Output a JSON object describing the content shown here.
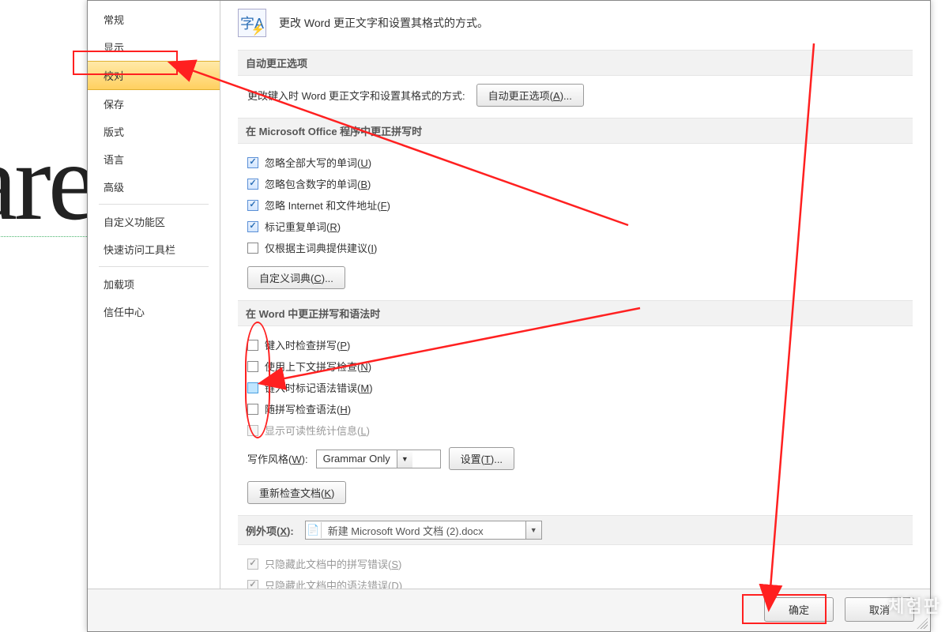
{
  "bg_text": "are",
  "header": {
    "icon_label": "字A",
    "description": "更改 Word 更正文字和设置其格式的方式。"
  },
  "sidebar": {
    "items": [
      {
        "label": "常规"
      },
      {
        "label": "显示"
      },
      {
        "label": "校对",
        "active": true
      },
      {
        "label": "保存"
      },
      {
        "label": "版式"
      },
      {
        "label": "语言"
      },
      {
        "label": "高级"
      }
    ],
    "items2": [
      {
        "label": "自定义功能区"
      },
      {
        "label": "快速访问工具栏"
      }
    ],
    "items3": [
      {
        "label": "加载项"
      },
      {
        "label": "信任中心"
      }
    ]
  },
  "sections": {
    "autocorrect": {
      "title": "自动更正选项",
      "row_label": "更改键入时 Word 更正文字和设置其格式的方式:",
      "button": "自动更正选项(A)..."
    },
    "office_spell": {
      "title": "在 Microsoft Office 程序中更正拼写时",
      "checks": [
        {
          "label": "忽略全部大写的单词(U)",
          "checked": true
        },
        {
          "label": "忽略包含数字的单词(B)",
          "checked": true
        },
        {
          "label": "忽略 Internet 和文件地址(F)",
          "checked": true
        },
        {
          "label": "标记重复单词(R)",
          "checked": true
        },
        {
          "label": "仅根据主词典提供建议(I)",
          "checked": false
        }
      ],
      "dict_button": "自定义词典(C)..."
    },
    "word_spell": {
      "title": "在 Word 中更正拼写和语法时",
      "checks": [
        {
          "label": "键入时检查拼写(P)",
          "checked": false
        },
        {
          "label": "使用上下文拼写检查(N)",
          "checked": false
        },
        {
          "label": "键入时标记语法错误(M)",
          "checked": false,
          "highlight": true
        },
        {
          "label": "随拼写检查语法(H)",
          "checked": false
        },
        {
          "label": "显示可读性统计信息(L)",
          "checked": false,
          "disabled": true
        }
      ],
      "style_label": "写作风格(W):",
      "style_value": "Grammar Only",
      "settings_button": "设置(T)...",
      "recheck_button": "重新检查文档(K)"
    },
    "exceptions": {
      "title_label": "例外项(X):",
      "doc_value": "新建 Microsoft Word 文档 (2).docx",
      "hide_spelling": "只隐藏此文档中的拼写错误(S)",
      "hide_grammar": "只隐藏此文档中的语法错误(D)"
    }
  },
  "footer": {
    "ok": "确定",
    "cancel": "取消"
  },
  "watermark": "체험판"
}
